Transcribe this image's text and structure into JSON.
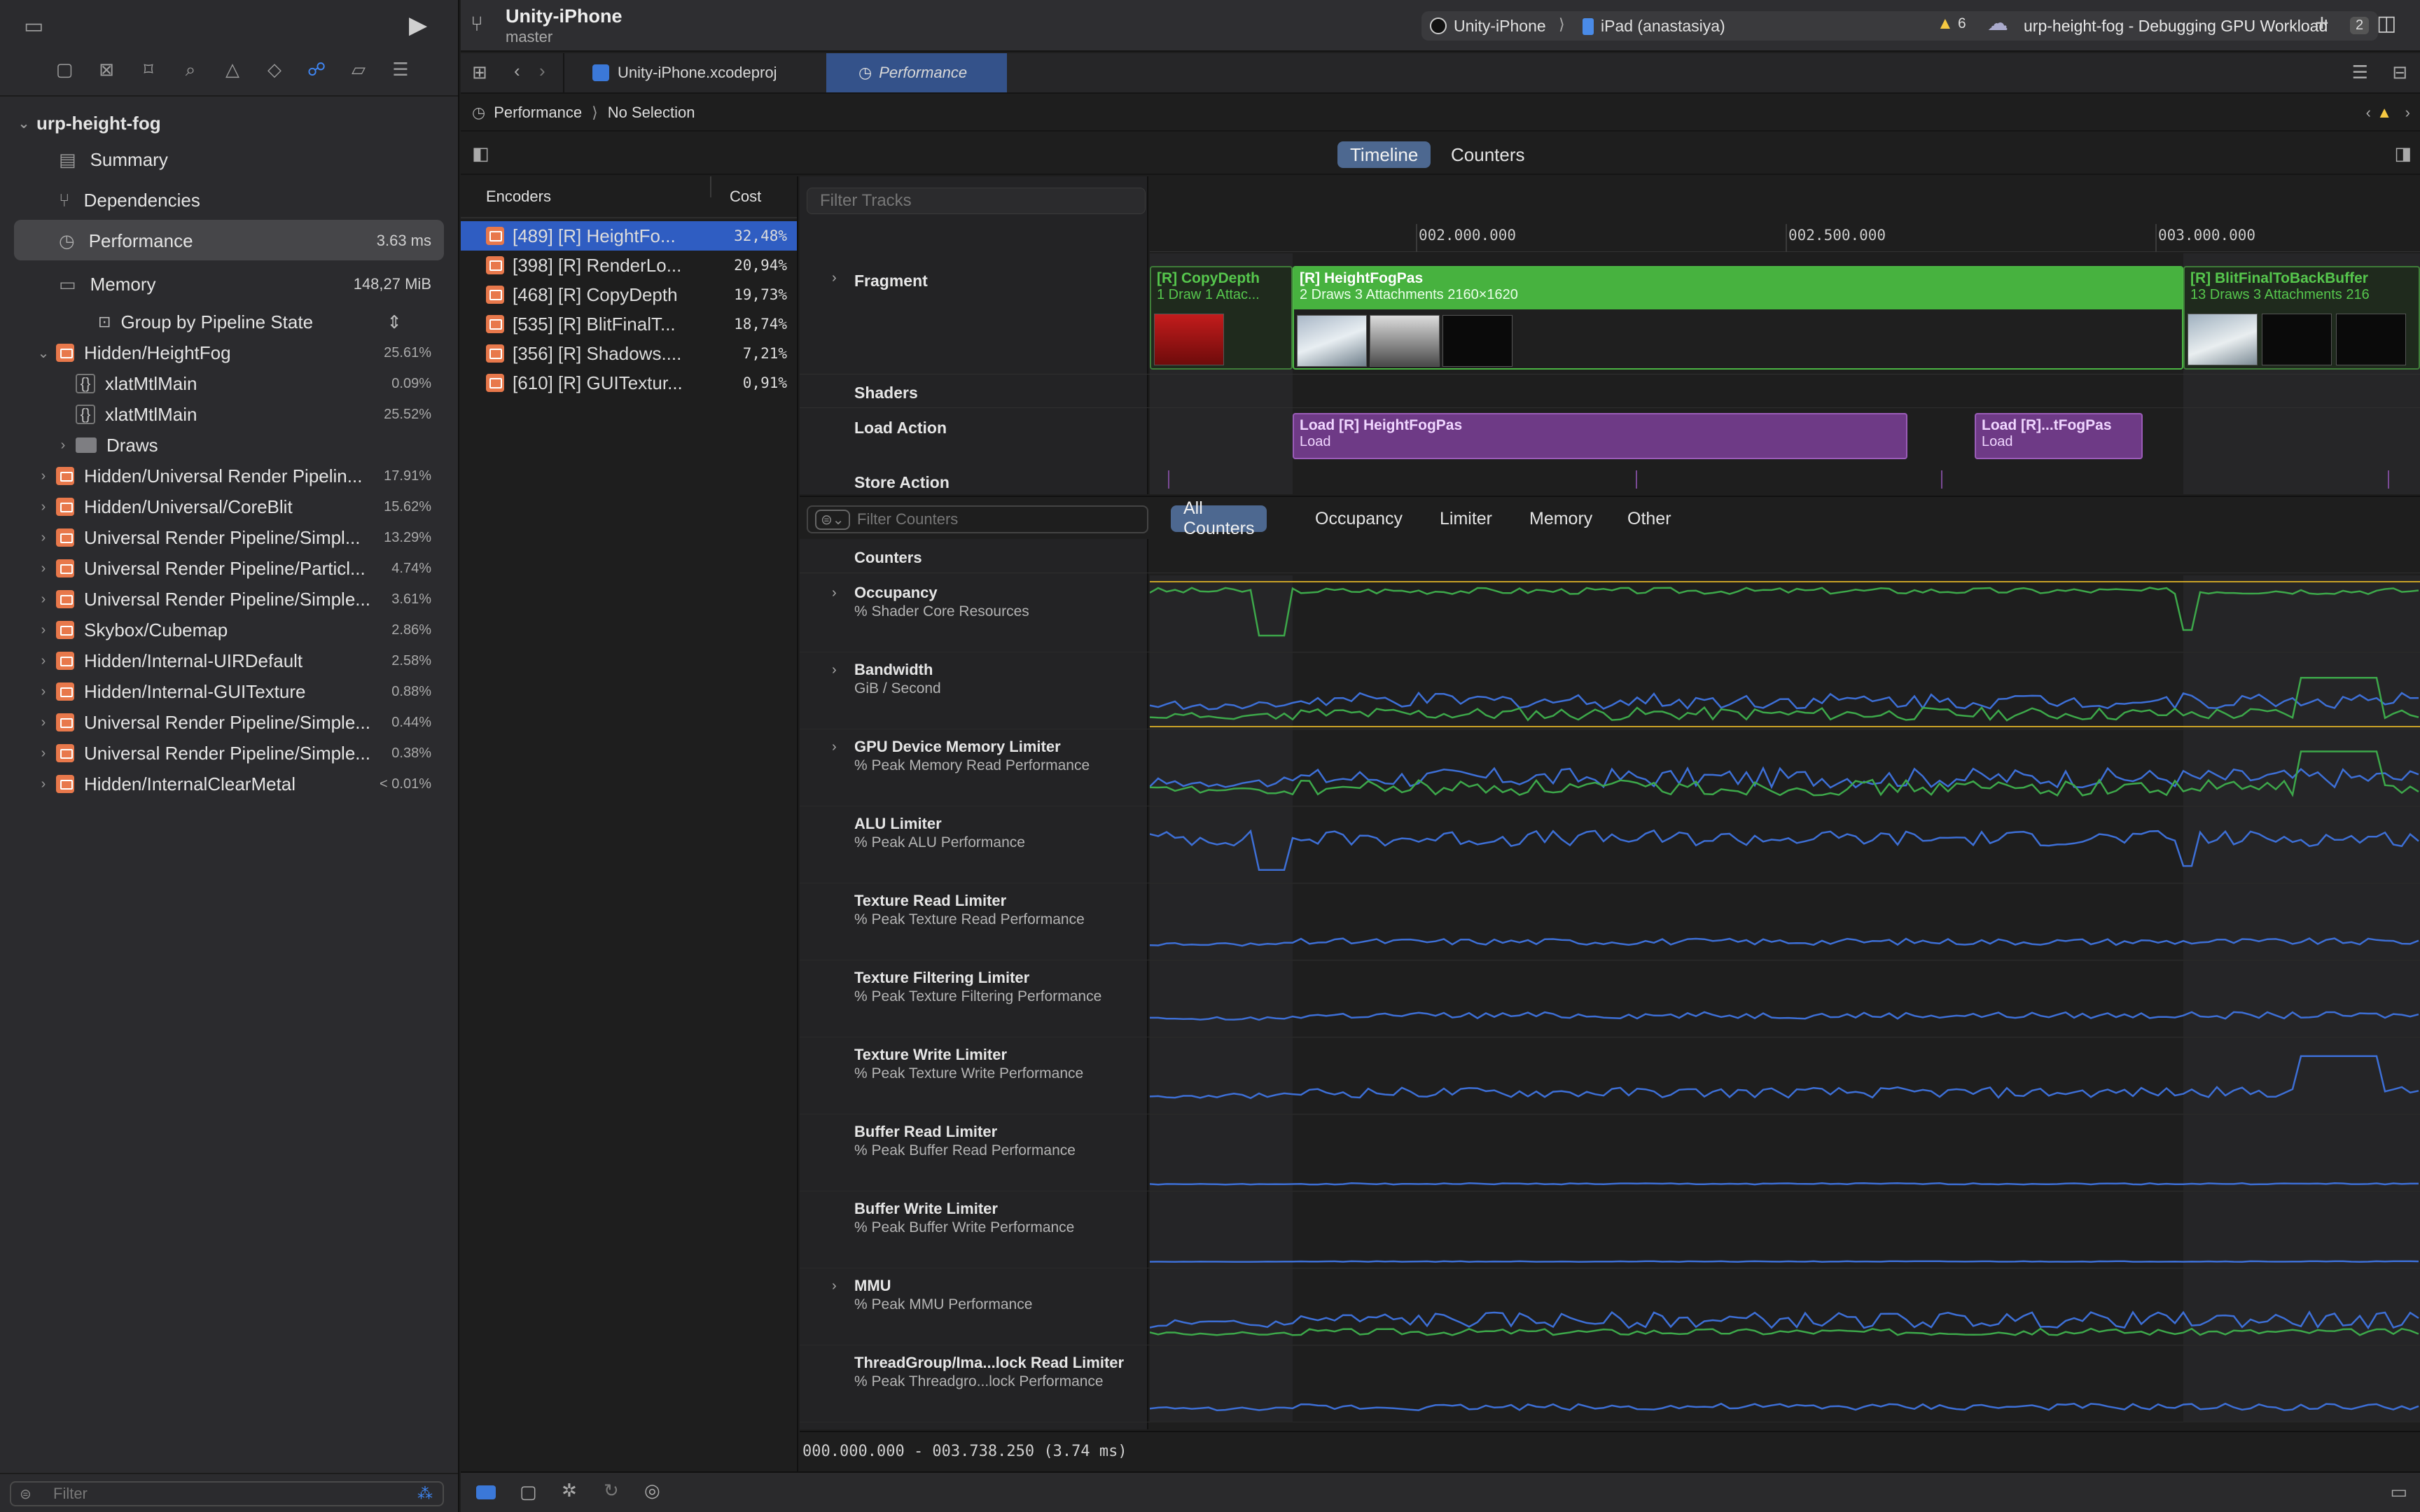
{
  "project": {
    "name": "urp-height-fog"
  },
  "sidebar": {
    "nav_items": [
      {
        "label": "Summary",
        "icon": "summary-icon"
      },
      {
        "label": "Dependencies",
        "icon": "dependencies-icon"
      },
      {
        "label": "Performance",
        "icon": "performance-icon",
        "value": "3.63 ms"
      },
      {
        "label": "Memory",
        "icon": "memory-icon",
        "value": "148,27 MiB"
      }
    ],
    "group_by": "Group by Pipeline State",
    "tree": [
      {
        "label": "Hidden/HeightFog",
        "pct": "25.61%",
        "expanded": true
      },
      {
        "label": "xlatMtlMain",
        "pct": "0.09%",
        "child": true
      },
      {
        "label": "xlatMtlMain",
        "pct": "25.52%",
        "child": true
      },
      {
        "label": "Draws",
        "pct": "",
        "child": true,
        "folder": true
      },
      {
        "label": "Hidden/Universal Render Pipelin...",
        "pct": "17.91%"
      },
      {
        "label": "Hidden/Universal/CoreBlit",
        "pct": "15.62%"
      },
      {
        "label": "Universal Render Pipeline/Simpl...",
        "pct": "13.29%"
      },
      {
        "label": "Universal Render Pipeline/Particl...",
        "pct": "4.74%"
      },
      {
        "label": "Universal Render Pipeline/Simple...",
        "pct": "3.61%"
      },
      {
        "label": "Skybox/Cubemap",
        "pct": "2.86%"
      },
      {
        "label": "Hidden/Internal-UIRDefault",
        "pct": "2.58%"
      },
      {
        "label": "Hidden/Internal-GUITexture",
        "pct": "0.88%"
      },
      {
        "label": "Universal Render Pipeline/Simple...",
        "pct": "0.44%"
      },
      {
        "label": "Universal Render Pipeline/Simple...",
        "pct": "0.38%"
      },
      {
        "label": "Hidden/InternalClearMetal",
        "pct": "< 0.01%"
      }
    ],
    "filter_placeholder": "Filter"
  },
  "toolbar": {
    "app_title": "Unity-iPhone",
    "branch": "master",
    "scheme": "Unity-iPhone",
    "device": "iPad (anastasiya)",
    "status": "urp-height-fog - Debugging GPU Workload",
    "status_count": "2",
    "warnings": "6"
  },
  "tabs": [
    {
      "label": "Unity-iPhone.xcodeproj"
    },
    {
      "label": "Performance"
    }
  ],
  "jumpbar": {
    "item1": "Performance",
    "item2": "No Selection"
  },
  "modes": {
    "timeline": "Timeline",
    "counters": "Counters"
  },
  "encoders": {
    "header_name": "Encoders",
    "header_cost": "Cost",
    "rows": [
      {
        "name": "[489] [R] HeightFo...",
        "cost": "32,48%",
        "selected": true
      },
      {
        "name": "[398] [R] RenderLo...",
        "cost": "20,94%"
      },
      {
        "name": "[468] [R] CopyDepth",
        "cost": "19,73%"
      },
      {
        "name": "[535] [R] BlitFinalT...",
        "cost": "18,74%"
      },
      {
        "name": "[356] [R] Shadows....",
        "cost": "7,21%"
      },
      {
        "name": "[610] [R] GUITextur...",
        "cost": "0,91%"
      }
    ]
  },
  "timeline": {
    "filter_placeholder": "Filter Tracks",
    "ruler": [
      "002.000.000",
      "002.500.000",
      "003.000.000"
    ],
    "tracks": {
      "fragment": "Fragment",
      "shaders": "Shaders",
      "load_action": "Load Action",
      "store_action": "Store Action"
    },
    "blocks": [
      {
        "title": "[R] CopyDepth",
        "sub": "1 Draw    1 Attac..."
      },
      {
        "title": "[R] HeightFogPas",
        "sub": "2 Draws    3 Attachments    2160×1620"
      },
      {
        "title": "[R] BlitFinalToBackBuffer",
        "sub": "13 Draws    3 Attachments    216"
      }
    ],
    "loads": [
      {
        "title": "Load [R] HeightFogPas",
        "sub": "Load"
      },
      {
        "title": "Load [R]...tFogPas",
        "sub": "Load"
      }
    ]
  },
  "counters": {
    "filter_placeholder": "Filter Counters",
    "filters": [
      "All Counters",
      "Occupancy",
      "Limiter",
      "Memory",
      "Other"
    ],
    "header": "Counters",
    "rows": [
      {
        "name": "Occupancy",
        "sub": "% Shader Core Resources",
        "expandable": true
      },
      {
        "name": "Bandwidth",
        "sub": "GiB / Second",
        "expandable": true
      },
      {
        "name": "GPU Device Memory Limiter",
        "sub": "% Peak Memory Read Performance",
        "expandable": true
      },
      {
        "name": "ALU Limiter",
        "sub": "% Peak ALU Performance",
        "expandable": false
      },
      {
        "name": "Texture Read Limiter",
        "sub": "% Peak Texture Read Performance",
        "expandable": false
      },
      {
        "name": "Texture Filtering Limiter",
        "sub": "% Peak Texture Filtering Performance",
        "expandable": false
      },
      {
        "name": "Texture Write Limiter",
        "sub": "% Peak Texture Write Performance",
        "expandable": false
      },
      {
        "name": "Buffer Read Limiter",
        "sub": "% Peak Buffer Read Performance",
        "expandable": false
      },
      {
        "name": "Buffer Write Limiter",
        "sub": "% Peak Buffer Write Performance",
        "expandable": false
      },
      {
        "name": "MMU",
        "sub": "% Peak MMU Performance",
        "expandable": true
      },
      {
        "name": "ThreadGroup/Ima...lock Read Limiter",
        "sub": "% Peak Threadgro...lock Performance",
        "expandable": false
      }
    ]
  },
  "range": "000.000.000 - 003.738.250 (3.74 ms)",
  "colors": {
    "accent": "#2f5dc2",
    "green": "#4bb543",
    "purple": "#6e3a86",
    "line_blue": "#3d6fd6",
    "line_green": "#3da84a"
  }
}
